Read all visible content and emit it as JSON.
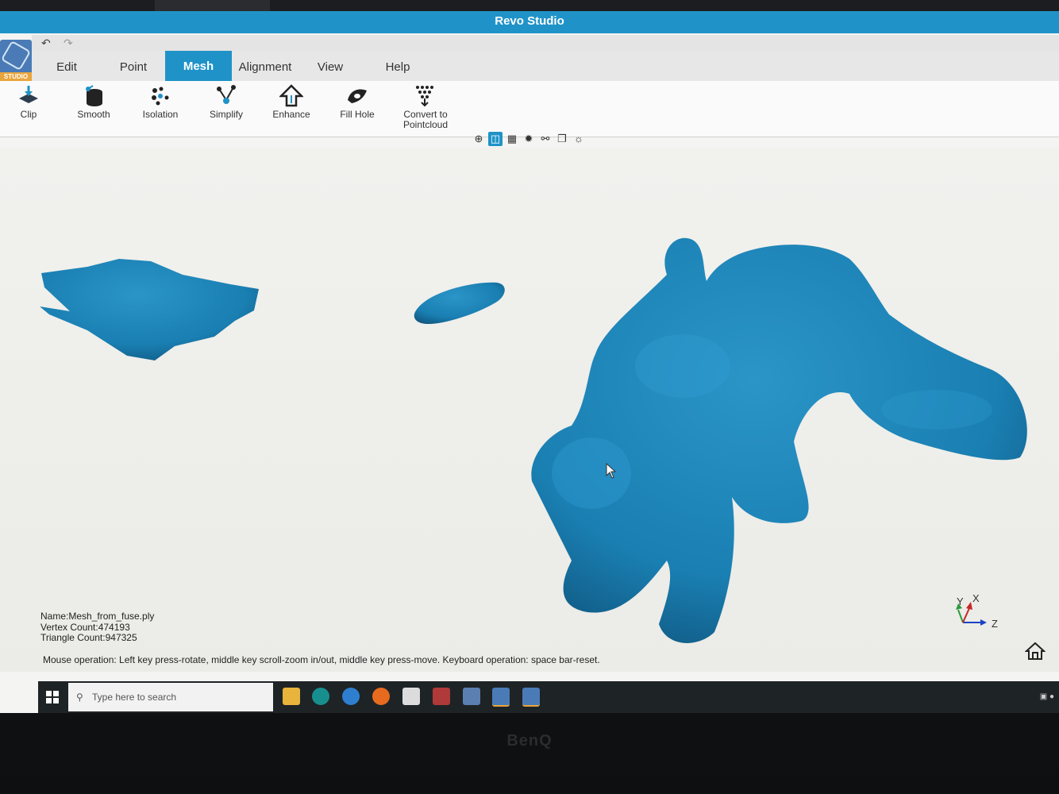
{
  "window": {
    "title": "Revo Studio"
  },
  "logo": {
    "text": "STUDIO"
  },
  "quick_access": {
    "undo_icon": "undo-icon",
    "redo_icon": "redo-icon"
  },
  "menu": {
    "tabs": [
      {
        "label": "Edit"
      },
      {
        "label": "Point"
      },
      {
        "label": "Mesh",
        "active": true
      },
      {
        "label": "Alignment"
      },
      {
        "label": "View"
      },
      {
        "label": "Help"
      }
    ]
  },
  "ribbon": {
    "tools": [
      {
        "label": "Clip",
        "icon": "clip-icon"
      },
      {
        "label": "Smooth",
        "icon": "smooth-icon"
      },
      {
        "label": "Isolation",
        "icon": "isolation-icon"
      },
      {
        "label": "Simplify",
        "icon": "simplify-icon"
      },
      {
        "label": "Enhance",
        "icon": "enhance-icon"
      },
      {
        "label": "Fill Hole",
        "icon": "fill-hole-icon"
      },
      {
        "label": "Convert to Pointcloud",
        "label_line1": "Convert to",
        "label_line2": "Pointcloud",
        "icon": "convert-pointcloud-icon"
      }
    ]
  },
  "view_toolbar": {
    "icons": [
      "target-icon",
      "cube-icon",
      "texture-icon",
      "lighting-icon",
      "globe-icon",
      "window-icon",
      "chat-icon"
    ],
    "active_index": 1
  },
  "mesh_info": {
    "name": "Name:Mesh_from_fuse.ply",
    "vertex_count": "Vertex Count:474193",
    "triangle_count": "Triangle Count:947325"
  },
  "status_hint": "Mouse operation: Left key press-rotate, middle key scroll-zoom in/out, middle key press-move.  Keyboard operation: space bar-reset.",
  "axes": {
    "y": "Y",
    "x": "X",
    "z": "Z"
  },
  "colors": {
    "accent": "#1f93c8",
    "mesh": "#1a7fb2",
    "viewport_bg": "#f1f1ee"
  },
  "taskbar": {
    "search_placeholder": "Type here to search",
    "apps": [
      "file-explorer-icon",
      "arduino-icon",
      "edge-icon",
      "firefox-icon",
      "app-icon",
      "app-icon",
      "save-icon",
      "revo-studio-icon",
      "revo-studio-icon"
    ]
  },
  "monitor_brand": "BenQ"
}
